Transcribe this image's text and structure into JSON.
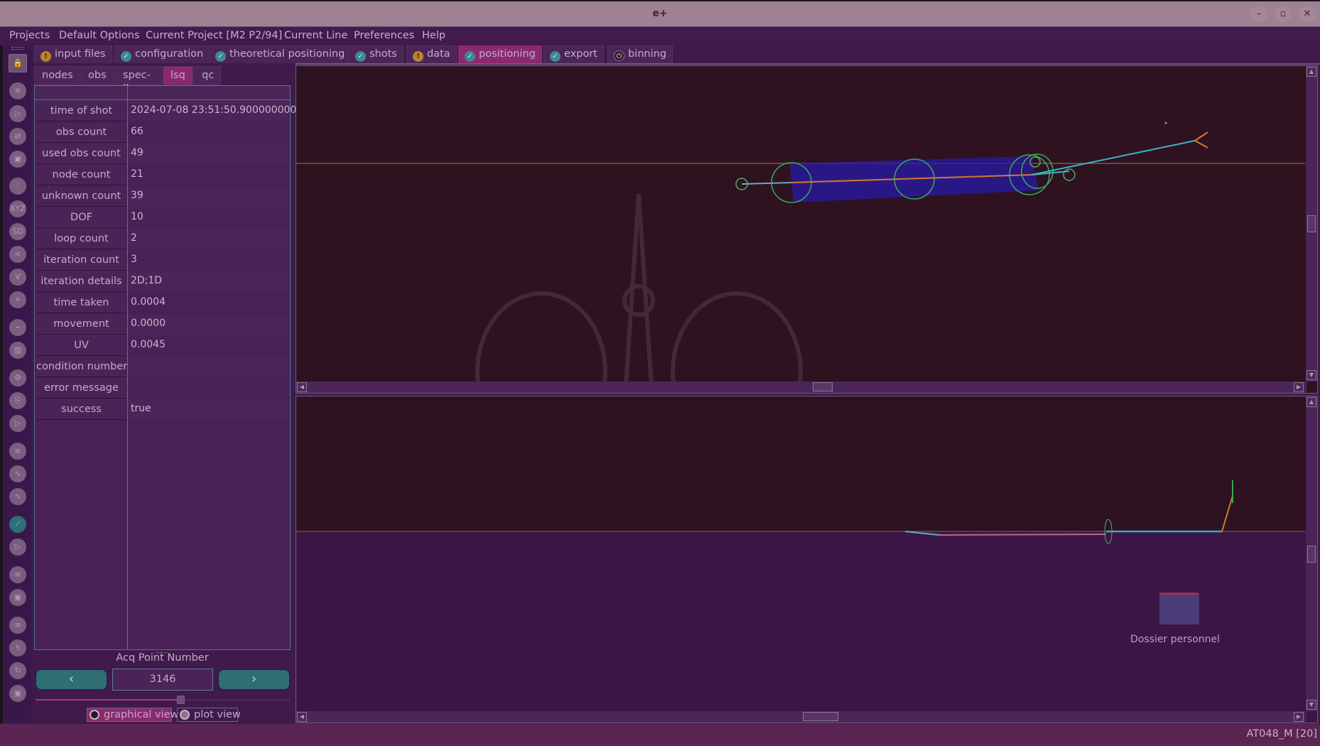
{
  "window": {
    "title": "e+",
    "controls": [
      "minimize",
      "maximize",
      "close"
    ]
  },
  "menu": [
    "Projects",
    "Default Options",
    "Current Project [M2 P2/94]",
    "Current Line",
    "Preferences",
    "Help"
  ],
  "workflow_tabs": [
    {
      "label": "input files",
      "status": "warning"
    },
    {
      "label": "configuration",
      "status": "ok"
    },
    {
      "label": "theoretical positioning",
      "status": "ok"
    },
    {
      "label": "shots",
      "status": "ok"
    },
    {
      "label": "data",
      "status": "warning"
    },
    {
      "label": "positioning",
      "status": "ok",
      "active": true
    },
    {
      "label": "export",
      "status": "ok"
    },
    {
      "label": "binning",
      "status": "off"
    }
  ],
  "sub_tabs": [
    {
      "label": "nodes"
    },
    {
      "label": "obs"
    },
    {
      "label": "spec-x"
    },
    {
      "label": "lsq",
      "active": true
    },
    {
      "label": "qc"
    }
  ],
  "toolbar_icons": [
    "lock-icon",
    "file-icon",
    "play-icon",
    "swap-icon",
    "save-icon",
    "sensor-array-icon",
    "xyz-icon",
    "sd-icon",
    "share-network-icon",
    "triangle-network-icon",
    "map-pin-icon",
    "cable-icon",
    "map-icon",
    "gear-icon",
    "usb-icon",
    "video-icon",
    "document-icon",
    "waveform-icon",
    "waveform-alt-icon",
    "positioning-icon",
    "video-alt-icon",
    "document-alt-icon",
    "save-alt-icon",
    "document-export-icon",
    "lightning-icon",
    "refresh-icon",
    "save-final-icon"
  ],
  "lsq_table": [
    {
      "key": "time of shot",
      "value": "2024-07-08 23:51:50.900000000"
    },
    {
      "key": "obs count",
      "value": "66"
    },
    {
      "key": "used obs count",
      "value": "49"
    },
    {
      "key": "node count",
      "value": "21"
    },
    {
      "key": "unknown count",
      "value": "39"
    },
    {
      "key": "DOF",
      "value": "10"
    },
    {
      "key": "loop count",
      "value": "2"
    },
    {
      "key": "iteration count",
      "value": "3"
    },
    {
      "key": "iteration details",
      "value": "2D;1D"
    },
    {
      "key": "time taken",
      "value": "0.0004"
    },
    {
      "key": "movement",
      "value": "0.0000"
    },
    {
      "key": "UV",
      "value": "0.0045"
    },
    {
      "key": "condition number",
      "value": ""
    },
    {
      "key": "error message",
      "value": ""
    },
    {
      "key": "success",
      "value": "true"
    }
  ],
  "acq": {
    "label": "Acq Point Number",
    "value": "3146",
    "prev": "‹",
    "next": "›",
    "slider_fraction": 0.57
  },
  "view_mode": {
    "graphical_label": "graphical view",
    "plot_label": "plot view",
    "selected": "graphical view"
  },
  "desktop": {
    "folder_label": "Dossier personnel"
  },
  "status": {
    "right_text": "AT048_M [20]"
  }
}
